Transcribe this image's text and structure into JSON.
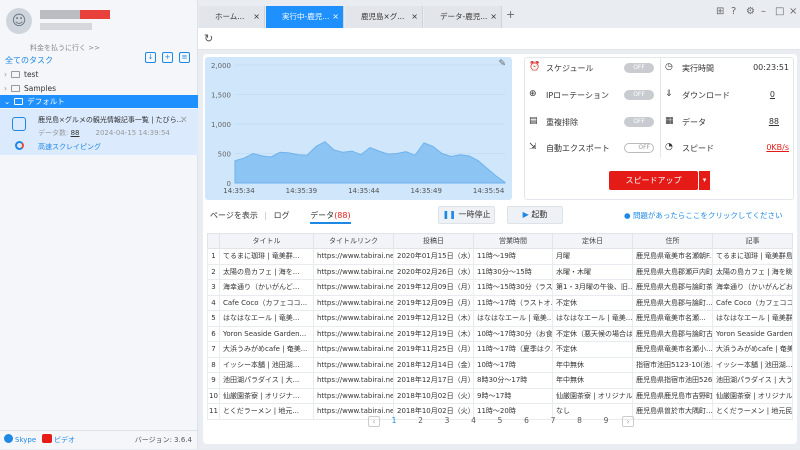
{
  "sidebar": {
    "pay_link": "料金を払うに行く >>",
    "all_tasks": "全てのタスク",
    "folders": [
      {
        "name": "test"
      },
      {
        "name": "Samples"
      },
      {
        "name": "デフォルト"
      }
    ],
    "task": {
      "title": "鹿児島×グルメの観光情報記事一覧 | たびら...",
      "data_label": "データ数:",
      "data_count": "88",
      "date": "2024-04-15 14:39:54",
      "mode": "高速スクレイピング"
    },
    "footer": {
      "skype": "Skype",
      "video": "ビデオ",
      "version": "バージョン: 3.6.4"
    }
  },
  "tabs": [
    {
      "label": "ホーム..."
    },
    {
      "label": "実行中-鹿児..."
    },
    {
      "label": "鹿児島×グ..."
    },
    {
      "label": "データ-鹿児..."
    }
  ],
  "stats": {
    "schedule": "スケジュール",
    "ip_rotation": "IPローテーション",
    "dedupe": "重複排除",
    "auto_export": "自動エクスポート",
    "off": "OFF",
    "run_time_label": "実行時間",
    "run_time": "00:23:51",
    "download_label": "ダウンロード",
    "download": "0",
    "data_label": "データ",
    "data": "88",
    "speed_label": "スピード",
    "speed": "0KB/s",
    "speed_up": "スピードアップ"
  },
  "chart_data": {
    "type": "area",
    "y_ticks": [
      "2,000",
      "1,500",
      "1,000",
      "500",
      "0"
    ],
    "x_ticks": [
      "14:35:34",
      "14:35:39",
      "14:35:44",
      "14:35:49",
      "14:35:54"
    ],
    "ylim": [
      0,
      2000
    ],
    "values": [
      380,
      420,
      500,
      460,
      440,
      520,
      510,
      480,
      470,
      620,
      700,
      560,
      520,
      540,
      480,
      600,
      540,
      490,
      500,
      530,
      470,
      680,
      620,
      500,
      450,
      480,
      460,
      380,
      250,
      120,
      10
    ]
  },
  "subtabs": {
    "page": "ページを表示",
    "log": "ログ",
    "data": "データ",
    "data_count": "(88)"
  },
  "buttons": {
    "pause": "一時停止",
    "start": "起動",
    "help": "問題があったらここをクリックしてください"
  },
  "table": {
    "headers": [
      "",
      "タイトル",
      "タイトルリンク",
      "投稿日",
      "営業時間",
      "定休日",
      "住所",
      "記事"
    ],
    "rows": [
      [
        "1",
        "てるまに珈琲 | 竜美群...",
        "https://www.tabirai.net/s...",
        "2020年01月15日（水）",
        "11時～19時",
        "月曜",
        "鹿児島県竜美市名瀬朝F...",
        "てるまに珈琲 | 竜美群島..."
      ],
      [
        "2",
        "太陽の島カフェ | 海を...",
        "https://www.tabirai.net/s...",
        "2020年02月26日（水）",
        "11時30分～15時",
        "水曜・木曜",
        "鹿児島県大島郡瀬戸内町...",
        "太陽の島カフェ | 海を眺..."
      ],
      [
        "3",
        "海幸通り（かいがんど...",
        "https://www.tabirai.net/s...",
        "2019年12月09日（月）",
        "11時～15時30分（ラスト...",
        "第1・3月曜の午後、旧...",
        "鹿児島県大島郡与論町茶...",
        "海幸通り（かいがんどお..."
      ],
      [
        "4",
        "Cafe Coco（カフェココ...",
        "https://www.tabirai.net/s...",
        "2019年12月09日（月）",
        "11時～17時（ラストオ...",
        "不定休",
        "鹿児島県大島郡与論町...",
        "Cafe Coco（カフェココ）..."
      ],
      [
        "5",
        "はなはなエール | 竜美...",
        "https://www.tabirai.net/s...",
        "2019年12月12日（木）",
        "はなはなエール | 竜美...",
        "はなはなエール | 竜美...",
        "鹿児島県竜美市名瀬...",
        "はなはなエール | 竜美群..."
      ],
      [
        "6",
        "Yoron Seaside Garden...",
        "https://www.tabirai.net/s...",
        "2019年12月19日（木）",
        "10時～17時30分（お食...",
        "不定休（悪天候の場合は...",
        "鹿児島県大島郡与論町古...",
        "Yoron Seaside Garden（..."
      ],
      [
        "7",
        "大浜うみがめcafe | 奄美...",
        "https://www.tabirai.net/s...",
        "2019年11月25日（月）",
        "11時～17時（夏季はク...",
        "不定休",
        "鹿児島県竜美市名瀬小...",
        "大浜うみがめcafe | 奄美..."
      ],
      [
        "8",
        "イッシー本舗 | 池田湖...",
        "https://www.tabirai.net/s...",
        "2018年12月14日（金）",
        "10時～17時",
        "年中無休",
        "指宿市池田5123-10(池...",
        "イッシー本舗 | 池田湖..."
      ],
      [
        "9",
        "池田湖パラダイス | 大...",
        "https://www.tabirai.net/s...",
        "2018年12月17日（月）",
        "8時30分～17時",
        "年中無休",
        "鹿児島県指宿市池田5269",
        "池田湖パラダイス | 大う..."
      ],
      [
        "10",
        "仙厳園茶寮 | オリジナ...",
        "https://www.tabirai.net/s...",
        "2018年10月02日（火）",
        "9時～17時",
        "仙厳園茶寮 | オリジナル...",
        "鹿児島県鹿児島市吉野町...",
        "仙厳園茶寮 | オリジナル..."
      ],
      [
        "11",
        "とくだラーメン | 地元...",
        "https://www.tabirai.net/s...",
        "2018年10月02日（火）",
        "11時～20時",
        "なし",
        "鹿児島県曽於市大隅町...",
        "とくだラーメン | 地元民..."
      ]
    ]
  },
  "pager": [
    "1",
    "2",
    "3",
    "4",
    "5",
    "6",
    "7",
    "8",
    "9"
  ],
  "colors": {
    "accent": "#1e90ff",
    "speed": "#e41b17"
  }
}
